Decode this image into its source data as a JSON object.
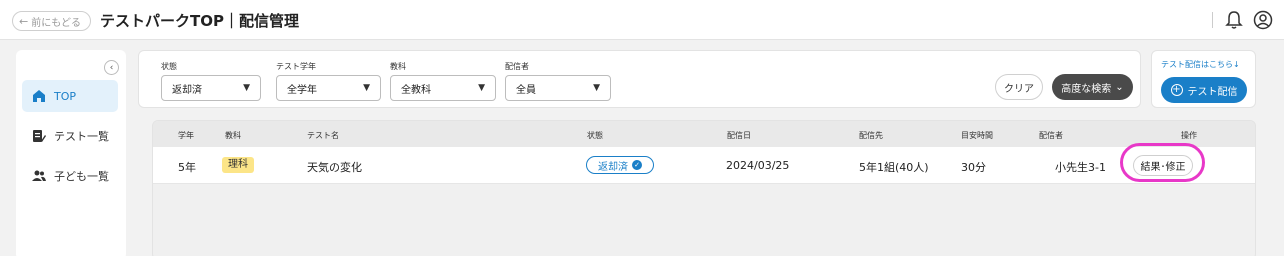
{
  "header": {
    "back_label": "前にもどる",
    "title": "テストパークTOP｜配信管理",
    "icons": [
      "bell-icon",
      "account-icon"
    ]
  },
  "sidebar": {
    "items": [
      {
        "label": "TOP",
        "icon": "home-icon",
        "active": true
      },
      {
        "label": "テスト一覧",
        "icon": "test-list-icon",
        "active": false
      },
      {
        "label": "子ども一覧",
        "icon": "people-icon",
        "active": false
      }
    ]
  },
  "filters": {
    "status": {
      "label": "状態",
      "value": "返却済"
    },
    "grade": {
      "label": "テスト学年",
      "value": "全学年"
    },
    "subject": {
      "label": "教科",
      "value": "全教科"
    },
    "distributor": {
      "label": "配信者",
      "value": "全員"
    },
    "clear_label": "クリア",
    "advanced_label": "高度な検索"
  },
  "distribution": {
    "link_label": "テスト配信はこちら",
    "button_label": "テスト配信"
  },
  "table": {
    "headers": [
      "学年",
      "教科",
      "テスト名",
      "状態",
      "配信日",
      "配信先",
      "目安時間",
      "配信者",
      "操作"
    ],
    "rows": [
      {
        "grade": "5年",
        "subject": "理科",
        "test_name": "天気の変化",
        "status": "返却済",
        "date": "2024/03/25",
        "destination": "5年1組(40人)",
        "time": "30分",
        "distributor": "小先生3-1",
        "action": "結果･修正"
      }
    ]
  },
  "colors": {
    "accent": "#1a7fc8",
    "subject_tag": "#fce588",
    "highlight": "#e838c8",
    "dark_button": "#4a4a4a"
  }
}
